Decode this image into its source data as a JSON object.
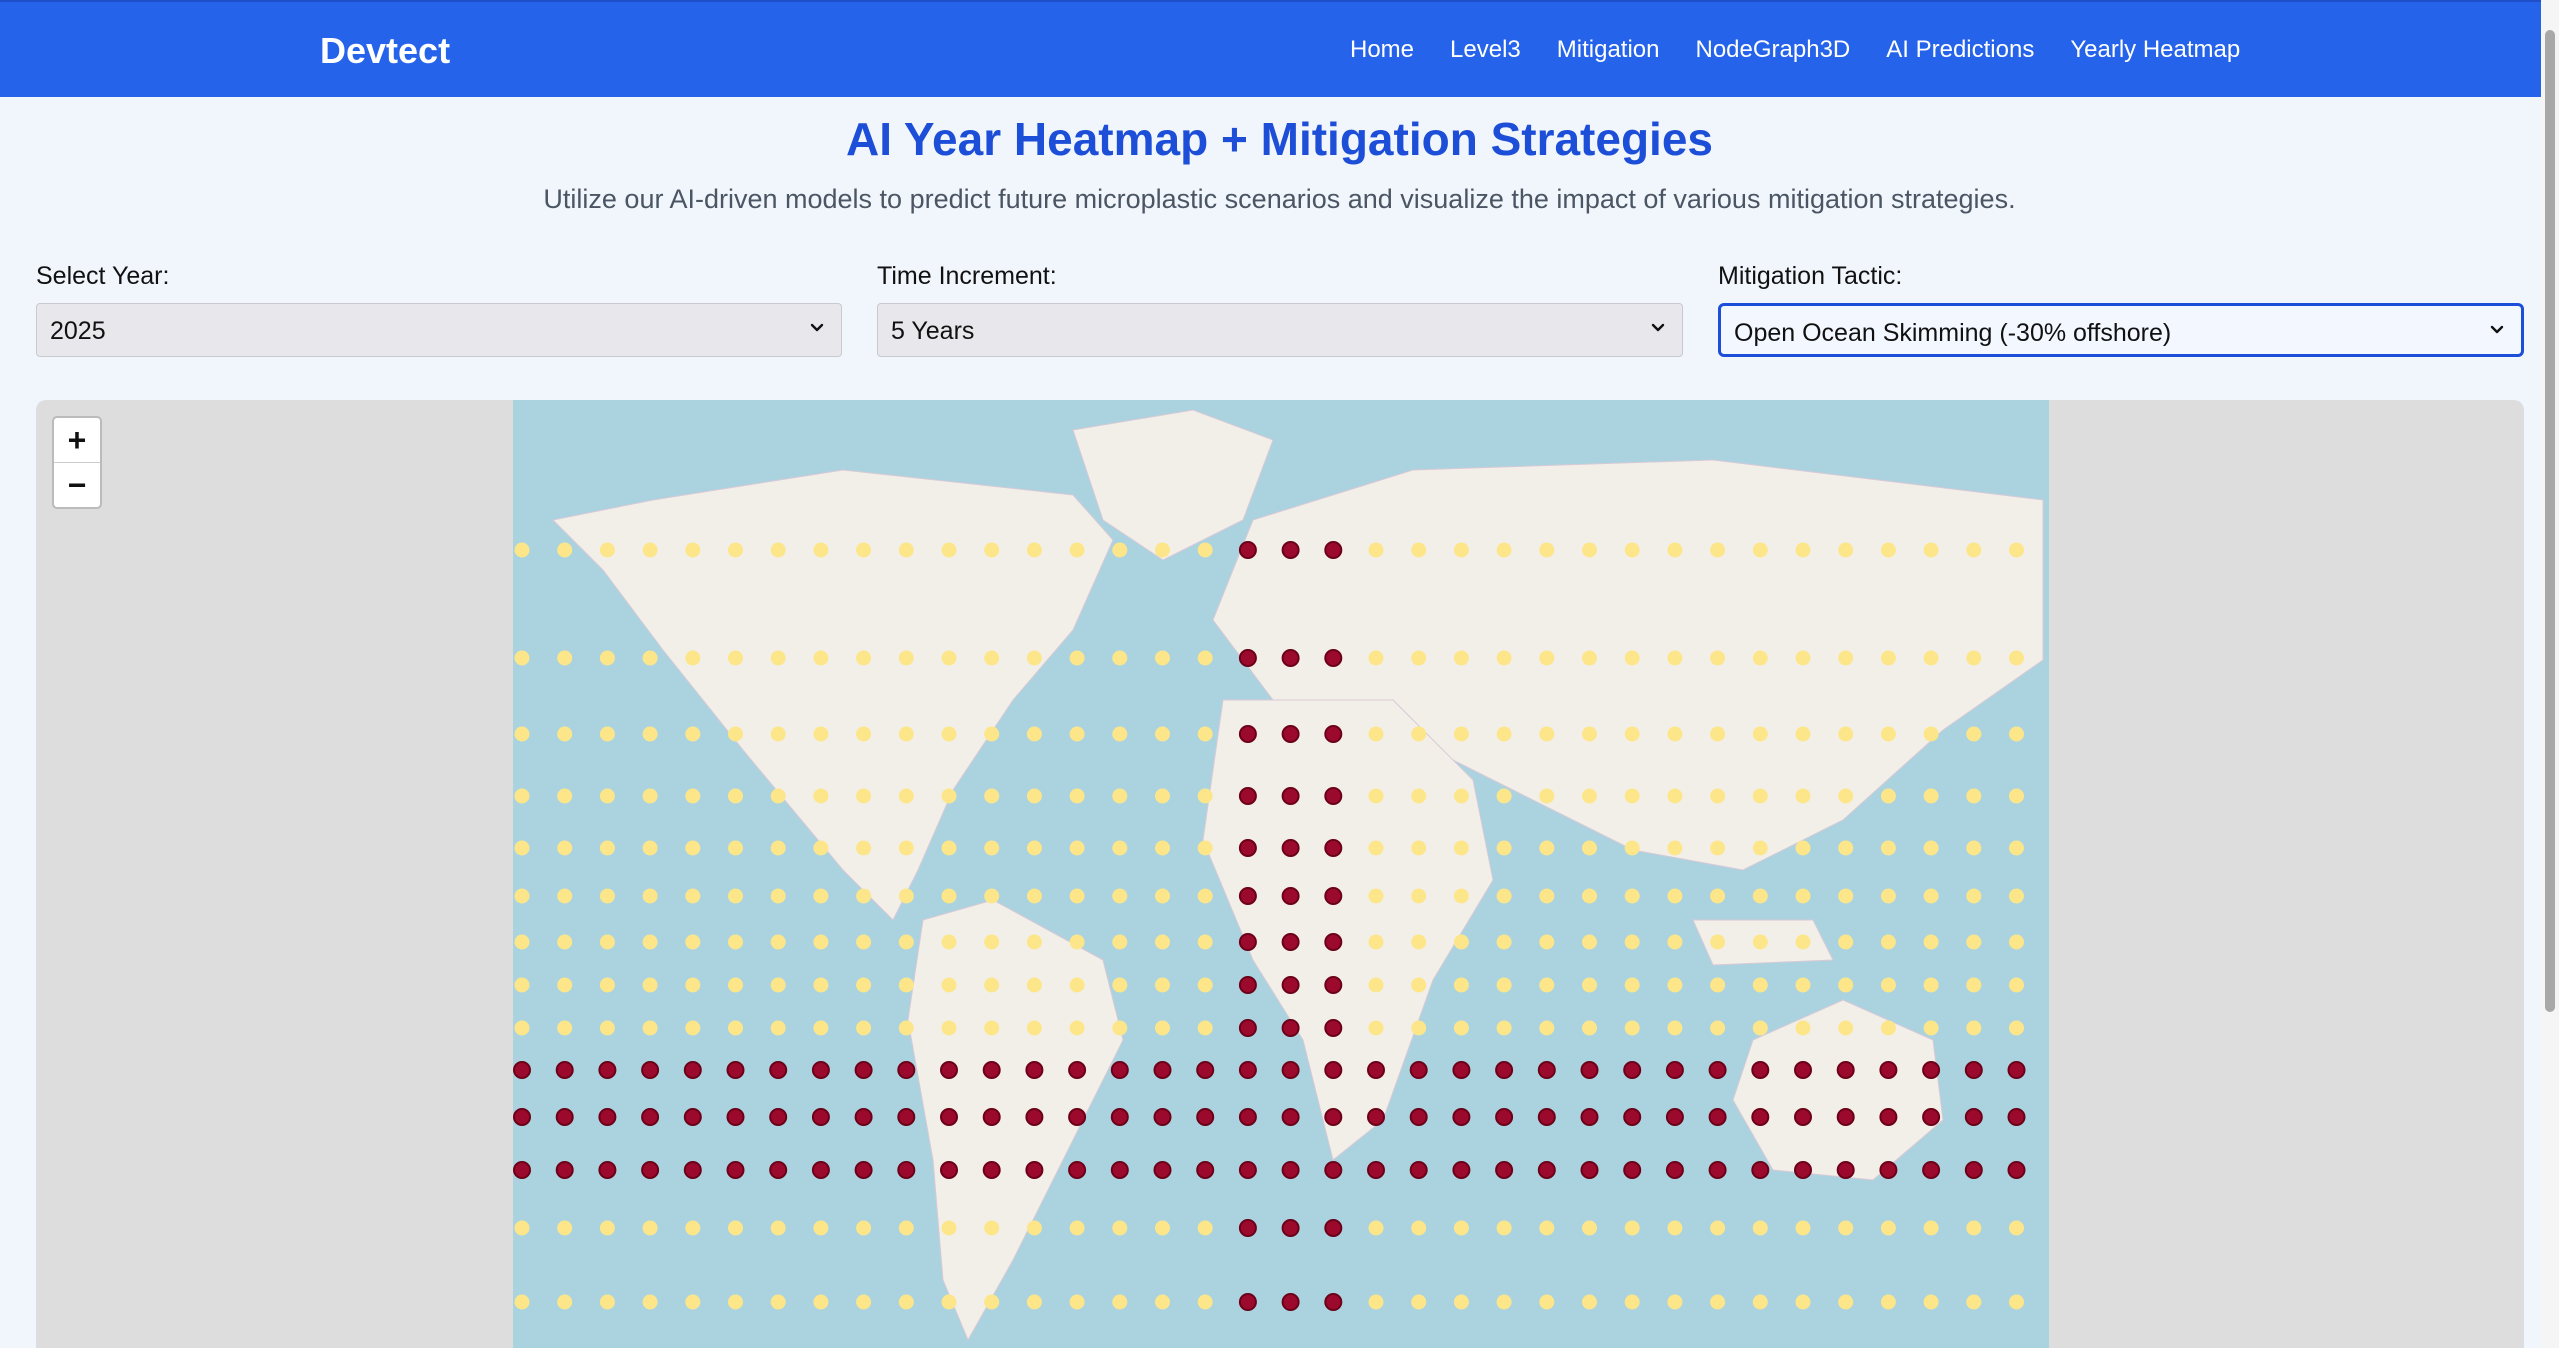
{
  "nav": {
    "brand": "Devtect",
    "links": [
      "Home",
      "Level3",
      "Mitigation",
      "NodeGraph3D",
      "AI Predictions",
      "Yearly Heatmap"
    ]
  },
  "header": {
    "title": "AI Year Heatmap + Mitigation Strategies",
    "subtitle": "Utilize our AI-driven models to predict future microplastic scenarios and visualize the impact of various mitigation strategies."
  },
  "controls": {
    "year": {
      "label": "Select Year:",
      "value": "2025"
    },
    "increment": {
      "label": "Time Increment:",
      "value": "5 Years"
    },
    "tactic": {
      "label": "Mitigation Tactic:",
      "value": "Open Ocean Skimming (-30% offshore)"
    }
  },
  "map": {
    "zoom_in": "+",
    "zoom_out": "−",
    "colors": {
      "ocean": "#aad3df",
      "land": "#f2efe9",
      "mitigated_marker": "#9b0a2d",
      "unmitigated_marker": "#fde68a"
    },
    "grid": {
      "rows": 14,
      "cols": 36
    },
    "mitigated_rows": [
      9,
      10,
      11
    ],
    "mitigated_cols": [
      17,
      18,
      19
    ]
  }
}
